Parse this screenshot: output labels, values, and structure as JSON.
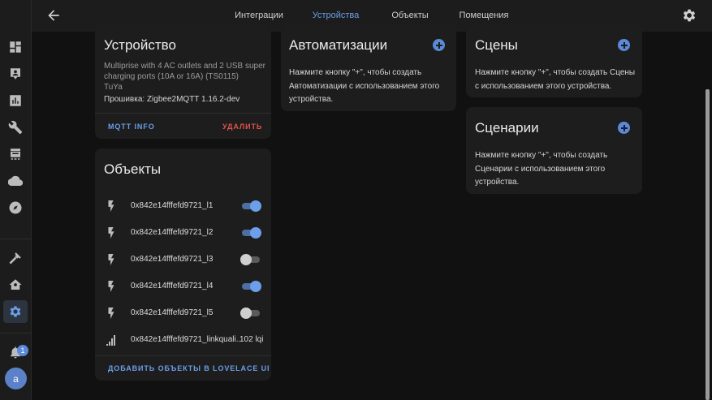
{
  "tabs": [
    {
      "label": "Интеграции"
    },
    {
      "label": "Устройства"
    },
    {
      "label": "Объекты"
    },
    {
      "label": "Помещения"
    }
  ],
  "sidebar": {
    "notification_count": "1",
    "avatar_initial": "a"
  },
  "device_card": {
    "title": "Устройство",
    "model": "Multiprise with 4 AC outlets and 2 USB super charging ports (10A or 16A) (TS0115)",
    "manufacturer": "TuYa",
    "firmware": "Прошивка: Zigbee2MQTT 1.16.2-dev",
    "mqtt_info_label": "MQTT INFO",
    "delete_label": "УДАЛИТЬ"
  },
  "entities_card": {
    "title": "Объекты",
    "entities": [
      {
        "name": "0x842e14fffefd9721_l1",
        "state": "on",
        "icon": "flash-icon"
      },
      {
        "name": "0x842e14fffefd9721_l2",
        "state": "on",
        "icon": "flash-icon"
      },
      {
        "name": "0x842e14fffefd9721_l3",
        "state": "off",
        "icon": "flash-icon"
      },
      {
        "name": "0x842e14fffefd9721_l4",
        "state": "on",
        "icon": "flash-icon"
      },
      {
        "name": "0x842e14fffefd9721_l5",
        "state": "off",
        "icon": "flash-icon"
      }
    ],
    "linkquality_name": "0x842e14fffefd9721_linkquali...",
    "linkquality_value": "102 lqi",
    "add_lovelace_label": "ДОБАВИТЬ ОБЪЕКТЫ В LOVELACE UI"
  },
  "automations_card": {
    "title": "Автоматизации",
    "text": "Нажмите кнопку \"+\", чтобы создать Автоматизации с использованием этого устройства."
  },
  "scenes_card": {
    "title": "Сцены",
    "text": "Нажмите кнопку \"+\", чтобы создать Сцены с использованием этого устройства."
  },
  "scripts_card": {
    "title": "Сценарии",
    "text": "Нажмите кнопку \"+\", чтобы создать Сценарии с использованием этого устройства."
  },
  "colors": {
    "accent": "#6c9ee9",
    "danger": "#e2534b",
    "card": "#1d1d1d",
    "background": "#111111"
  }
}
